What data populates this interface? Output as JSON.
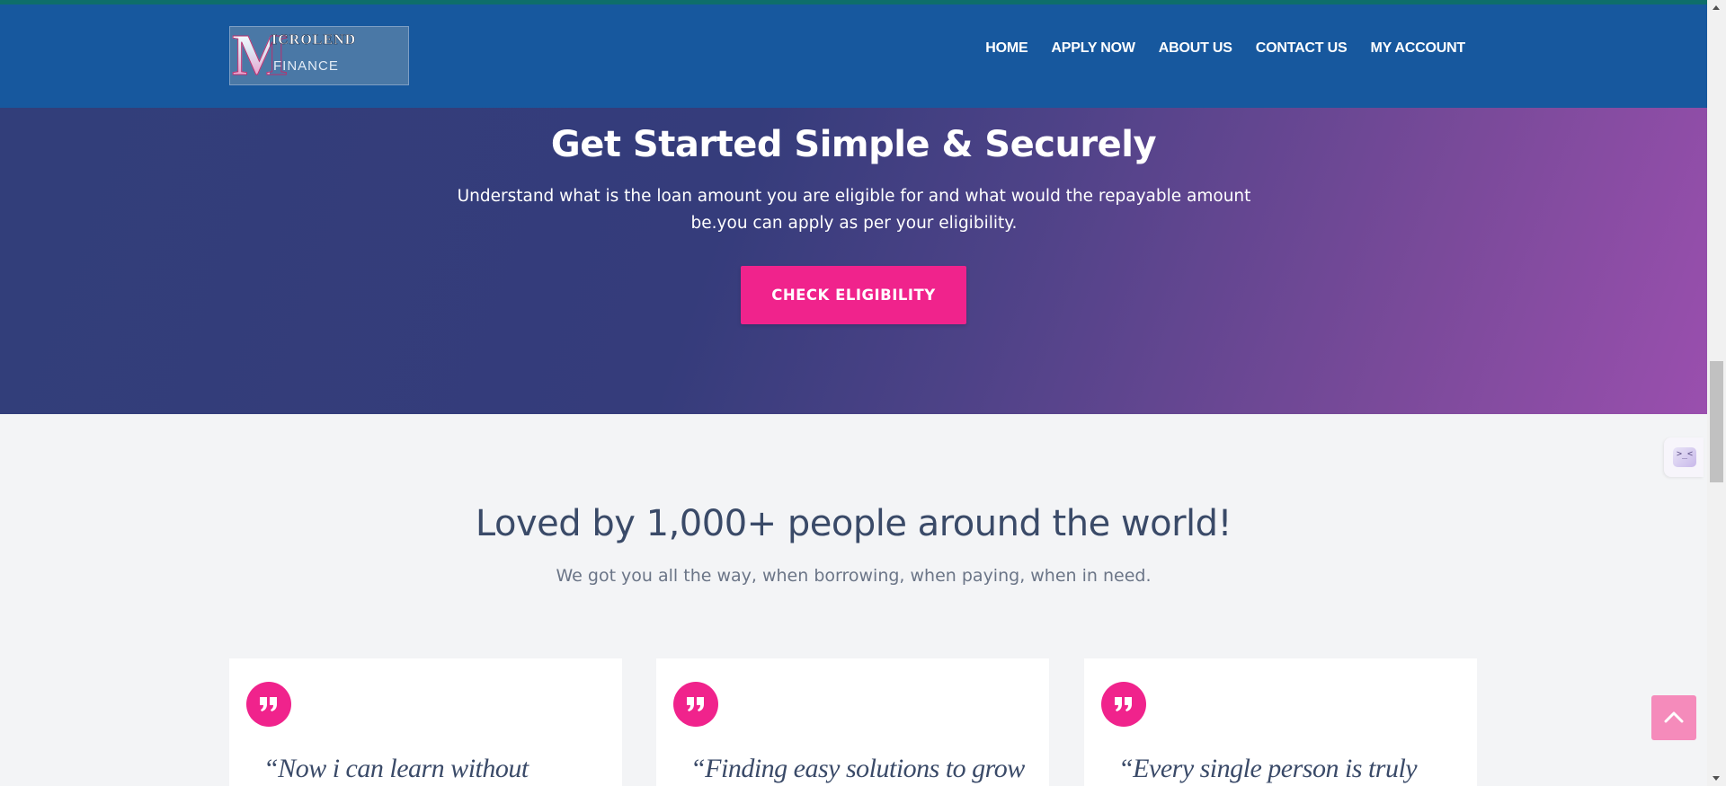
{
  "brand": {
    "logo_letter": "M",
    "logo_top": "ICROLEND",
    "logo_bottom": "FINANCE",
    "colors": {
      "header_bg": "#17589e",
      "accent": "#f0238c"
    }
  },
  "nav": {
    "items": [
      {
        "label": "HOME"
      },
      {
        "label": "APPLY NOW"
      },
      {
        "label": "ABOUT US"
      },
      {
        "label": "CONTACT US"
      },
      {
        "label": "MY ACCOUNT"
      }
    ]
  },
  "hero": {
    "title": "Get Started Simple & Securely",
    "subtitle": "Understand what is the loan amount you are eligible for and what would the repayable amount be.you can apply as per your eligibility.",
    "cta_label": "CHECK ELIGIBILITY"
  },
  "testimonials": {
    "title": "Loved by 1,000+ people around the world!",
    "subtitle": "We got you all the way, when borrowing, when paying, when in need.",
    "cards": [
      {
        "quote_icon": "quote-icon",
        "text": "“Now i can learn without"
      },
      {
        "quote_icon": "quote-icon",
        "text": "“Finding easy solutions to grow"
      },
      {
        "quote_icon": "quote-icon",
        "text": "“Every single person is truly"
      }
    ]
  },
  "widgets": {
    "side_widget_glyph": ">_<",
    "back_to_top_icon": "chevron-up-icon"
  }
}
